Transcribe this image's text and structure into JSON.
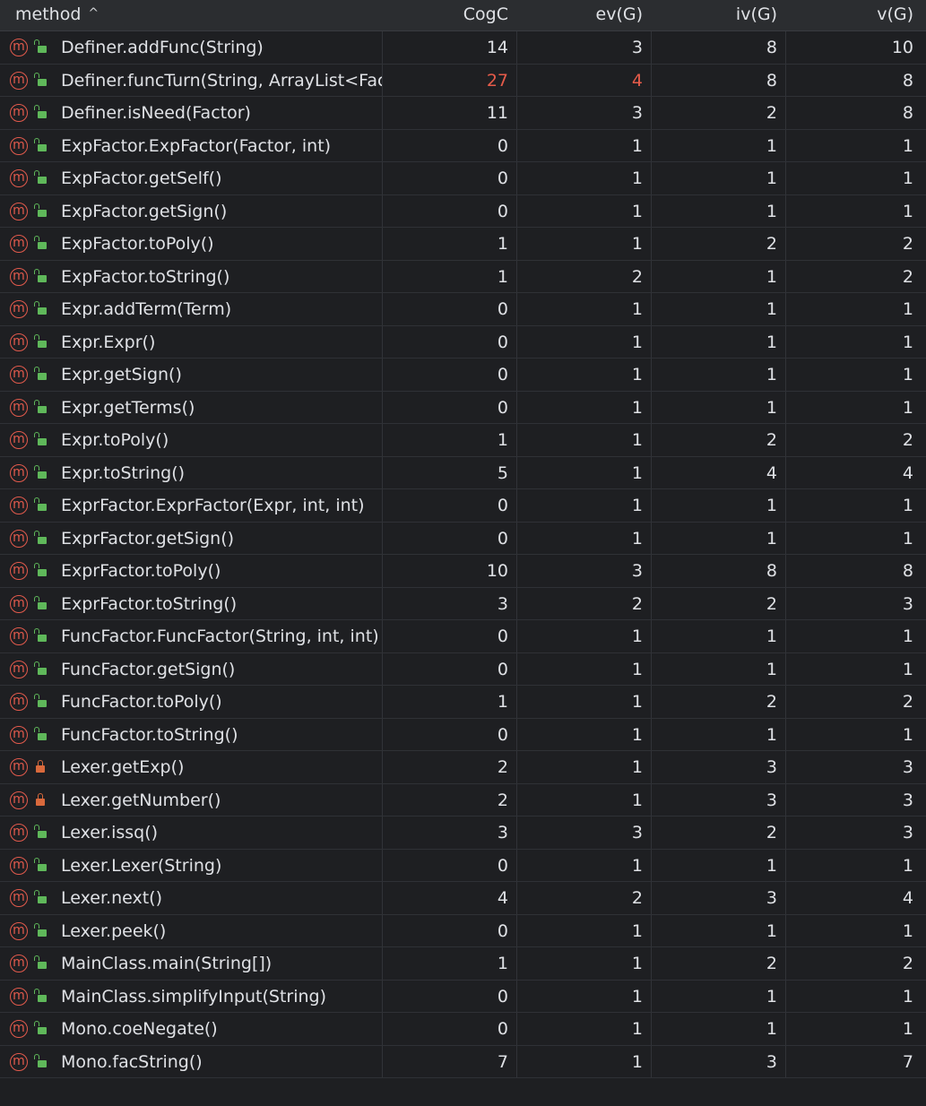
{
  "header": {
    "method": "method",
    "sort_icon": "^",
    "cogc": "CogC",
    "ev": "ev(G)",
    "iv": "iv(G)",
    "v": "v(G)"
  },
  "icons": {
    "method_glyph": "m"
  },
  "rows": [
    {
      "method": "Definer.addFunc(String)",
      "cogc": "14",
      "ev": "3",
      "iv": "8",
      "v": "10",
      "access": "public"
    },
    {
      "method": "Definer.funcTurn(String, ArrayList<Fact",
      "cogc": "27",
      "ev": "4",
      "iv": "8",
      "v": "8",
      "access": "public",
      "warn": true
    },
    {
      "method": "Definer.isNeed(Factor)",
      "cogc": "11",
      "ev": "3",
      "iv": "2",
      "v": "8",
      "access": "public"
    },
    {
      "method": "ExpFactor.ExpFactor(Factor, int)",
      "cogc": "0",
      "ev": "1",
      "iv": "1",
      "v": "1",
      "access": "public"
    },
    {
      "method": "ExpFactor.getSelf()",
      "cogc": "0",
      "ev": "1",
      "iv": "1",
      "v": "1",
      "access": "public"
    },
    {
      "method": "ExpFactor.getSign()",
      "cogc": "0",
      "ev": "1",
      "iv": "1",
      "v": "1",
      "access": "public"
    },
    {
      "method": "ExpFactor.toPoly()",
      "cogc": "1",
      "ev": "1",
      "iv": "2",
      "v": "2",
      "access": "public"
    },
    {
      "method": "ExpFactor.toString()",
      "cogc": "1",
      "ev": "2",
      "iv": "1",
      "v": "2",
      "access": "public"
    },
    {
      "method": "Expr.addTerm(Term)",
      "cogc": "0",
      "ev": "1",
      "iv": "1",
      "v": "1",
      "access": "public"
    },
    {
      "method": "Expr.Expr()",
      "cogc": "0",
      "ev": "1",
      "iv": "1",
      "v": "1",
      "access": "public"
    },
    {
      "method": "Expr.getSign()",
      "cogc": "0",
      "ev": "1",
      "iv": "1",
      "v": "1",
      "access": "public"
    },
    {
      "method": "Expr.getTerms()",
      "cogc": "0",
      "ev": "1",
      "iv": "1",
      "v": "1",
      "access": "public"
    },
    {
      "method": "Expr.toPoly()",
      "cogc": "1",
      "ev": "1",
      "iv": "2",
      "v": "2",
      "access": "public"
    },
    {
      "method": "Expr.toString()",
      "cogc": "5",
      "ev": "1",
      "iv": "4",
      "v": "4",
      "access": "public"
    },
    {
      "method": "ExprFactor.ExprFactor(Expr, int, int)",
      "cogc": "0",
      "ev": "1",
      "iv": "1",
      "v": "1",
      "access": "public"
    },
    {
      "method": "ExprFactor.getSign()",
      "cogc": "0",
      "ev": "1",
      "iv": "1",
      "v": "1",
      "access": "public"
    },
    {
      "method": "ExprFactor.toPoly()",
      "cogc": "10",
      "ev": "3",
      "iv": "8",
      "v": "8",
      "access": "public"
    },
    {
      "method": "ExprFactor.toString()",
      "cogc": "3",
      "ev": "2",
      "iv": "2",
      "v": "3",
      "access": "public"
    },
    {
      "method": "FuncFactor.FuncFactor(String, int, int)",
      "cogc": "0",
      "ev": "1",
      "iv": "1",
      "v": "1",
      "access": "public"
    },
    {
      "method": "FuncFactor.getSign()",
      "cogc": "0",
      "ev": "1",
      "iv": "1",
      "v": "1",
      "access": "public"
    },
    {
      "method": "FuncFactor.toPoly()",
      "cogc": "1",
      "ev": "1",
      "iv": "2",
      "v": "2",
      "access": "public"
    },
    {
      "method": "FuncFactor.toString()",
      "cogc": "0",
      "ev": "1",
      "iv": "1",
      "v": "1",
      "access": "public"
    },
    {
      "method": "Lexer.getExp()",
      "cogc": "2",
      "ev": "1",
      "iv": "3",
      "v": "3",
      "access": "private"
    },
    {
      "method": "Lexer.getNumber()",
      "cogc": "2",
      "ev": "1",
      "iv": "3",
      "v": "3",
      "access": "private"
    },
    {
      "method": "Lexer.issq()",
      "cogc": "3",
      "ev": "3",
      "iv": "2",
      "v": "3",
      "access": "public"
    },
    {
      "method": "Lexer.Lexer(String)",
      "cogc": "0",
      "ev": "1",
      "iv": "1",
      "v": "1",
      "access": "public"
    },
    {
      "method": "Lexer.next()",
      "cogc": "4",
      "ev": "2",
      "iv": "3",
      "v": "4",
      "access": "public"
    },
    {
      "method": "Lexer.peek()",
      "cogc": "0",
      "ev": "1",
      "iv": "1",
      "v": "1",
      "access": "public"
    },
    {
      "method": "MainClass.main(String[])",
      "cogc": "1",
      "ev": "1",
      "iv": "2",
      "v": "2",
      "access": "public"
    },
    {
      "method": "MainClass.simplifyInput(String)",
      "cogc": "0",
      "ev": "1",
      "iv": "1",
      "v": "1",
      "access": "public"
    },
    {
      "method": "Mono.coeNegate()",
      "cogc": "0",
      "ev": "1",
      "iv": "1",
      "v": "1",
      "access": "public"
    },
    {
      "method": "Mono.facString()",
      "cogc": "7",
      "ev": "1",
      "iv": "3",
      "v": "7",
      "access": "public"
    }
  ],
  "colors": {
    "warn": "#e55b4a",
    "method_icon": "#e25a4c",
    "public_lock": "#5fb85a",
    "private_lock": "#d9693c"
  }
}
